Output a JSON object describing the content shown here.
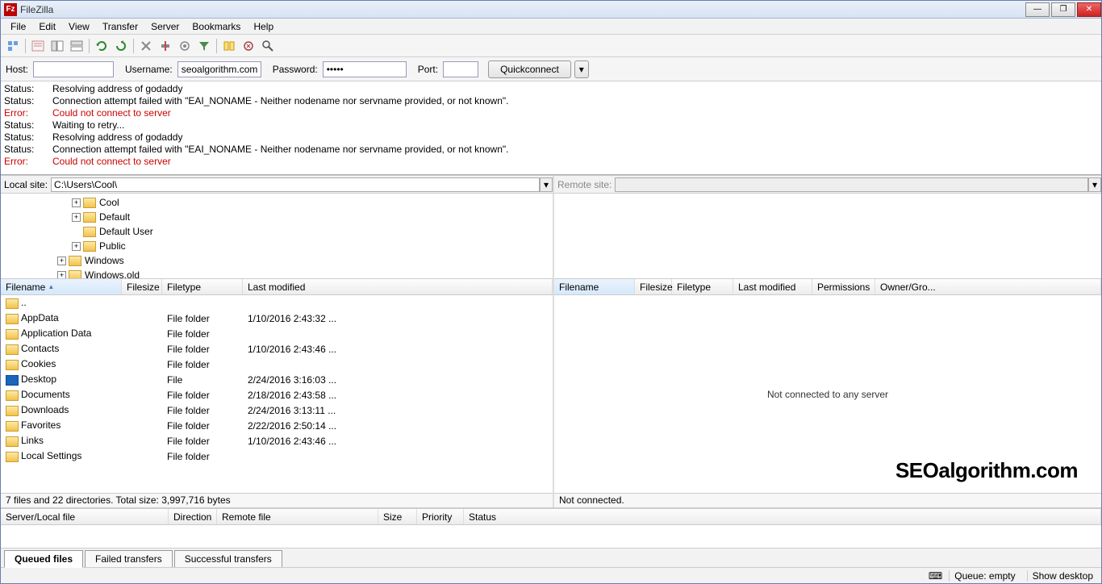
{
  "title": "FileZilla",
  "menu": [
    "File",
    "Edit",
    "View",
    "Transfer",
    "Server",
    "Bookmarks",
    "Help"
  ],
  "quick": {
    "host_lbl": "Host:",
    "host": "",
    "user_lbl": "Username:",
    "user": "seoalgorithm.com",
    "pass_lbl": "Password:",
    "pass": "•••••",
    "port_lbl": "Port:",
    "port": "",
    "btn": "Quickconnect"
  },
  "log": [
    {
      "t": "Status:",
      "m": "Resolving address of godaddy",
      "e": false
    },
    {
      "t": "Status:",
      "m": "Connection attempt failed with \"EAI_NONAME - Neither nodename nor servname provided, or not known\".",
      "e": false
    },
    {
      "t": "Error:",
      "m": "Could not connect to server",
      "e": true
    },
    {
      "t": "Status:",
      "m": "Waiting to retry...",
      "e": false
    },
    {
      "t": "Status:",
      "m": "Resolving address of godaddy",
      "e": false
    },
    {
      "t": "Status:",
      "m": "Connection attempt failed with \"EAI_NONAME - Neither nodename nor servname provided, or not known\".",
      "e": false
    },
    {
      "t": "Error:",
      "m": "Could not connect to server",
      "e": true
    }
  ],
  "local": {
    "site_lbl": "Local site:",
    "path": "C:\\Users\\Cool\\",
    "tree": [
      {
        "ind": 1,
        "exp": "+",
        "name": "Cool"
      },
      {
        "ind": 1,
        "exp": "+",
        "name": "Default"
      },
      {
        "ind": 1,
        "exp": "",
        "name": "Default User"
      },
      {
        "ind": 1,
        "exp": "+",
        "name": "Public"
      },
      {
        "ind": 0,
        "exp": "+",
        "name": "Windows"
      },
      {
        "ind": 0,
        "exp": "+",
        "name": "Windows.old"
      }
    ],
    "cols": {
      "fn": "Filename",
      "fs": "Filesize",
      "ft": "Filetype",
      "lm": "Last modified"
    },
    "files": [
      {
        "ic": "folder",
        "n": "..",
        "ft": "",
        "lm": ""
      },
      {
        "ic": "folder",
        "n": "AppData",
        "ft": "File folder",
        "lm": "1/10/2016 2:43:32 ..."
      },
      {
        "ic": "folder",
        "n": "Application Data",
        "ft": "File folder",
        "lm": ""
      },
      {
        "ic": "folder",
        "n": "Contacts",
        "ft": "File folder",
        "lm": "1/10/2016 2:43:46 ..."
      },
      {
        "ic": "folder",
        "n": "Cookies",
        "ft": "File folder",
        "lm": ""
      },
      {
        "ic": "desk",
        "n": "Desktop",
        "ft": "File",
        "lm": "2/24/2016 3:16:03 ..."
      },
      {
        "ic": "folder",
        "n": "Documents",
        "ft": "File folder",
        "lm": "2/18/2016 2:43:58 ..."
      },
      {
        "ic": "folder",
        "n": "Downloads",
        "ft": "File folder",
        "lm": "2/24/2016 3:13:11 ..."
      },
      {
        "ic": "folder",
        "n": "Favorites",
        "ft": "File folder",
        "lm": "2/22/2016 2:50:14 ..."
      },
      {
        "ic": "folder",
        "n": "Links",
        "ft": "File folder",
        "lm": "1/10/2016 2:43:46 ..."
      },
      {
        "ic": "folder",
        "n": "Local Settings",
        "ft": "File folder",
        "lm": ""
      }
    ],
    "status": "7 files and 22 directories. Total size: 3,997,716 bytes"
  },
  "remote": {
    "site_lbl": "Remote site:",
    "path": "",
    "cols": {
      "fn": "Filename",
      "fs": "Filesize",
      "ft": "Filetype",
      "lm": "Last modified",
      "pm": "Permissions",
      "og": "Owner/Gro..."
    },
    "empty": "Not connected to any server",
    "status": "Not connected."
  },
  "queue": {
    "cols": [
      "Server/Local file",
      "Direction",
      "Remote file",
      "Size",
      "Priority",
      "Status"
    ],
    "tabs": [
      "Queued files",
      "Failed transfers",
      "Successful transfers"
    ]
  },
  "statusbar": {
    "q": "Queue: empty",
    "sd": "Show desktop"
  },
  "watermark": "SEOalgorithm.com"
}
